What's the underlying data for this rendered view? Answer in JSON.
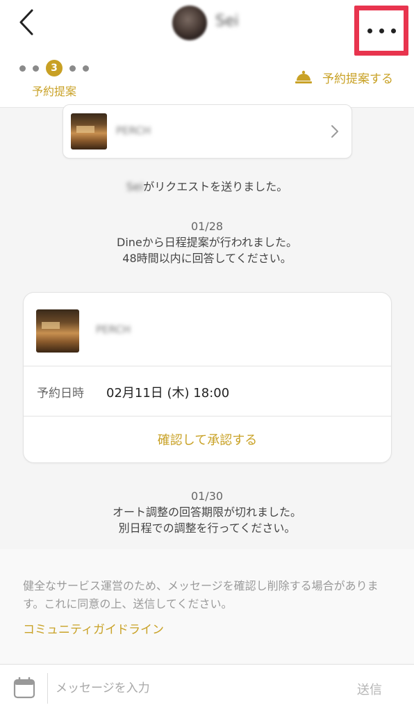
{
  "header": {
    "user_name": "Sei",
    "stepper": {
      "active_step": "3",
      "label": "予約提案"
    },
    "propose_link_label": "予約提案する"
  },
  "shop_card": {
    "name": "PERCH"
  },
  "messages": {
    "request_sent_user": "Sei",
    "request_sent_text": "がリクエストを送りました。",
    "proposal_date": "01/28",
    "proposal_line1": "Dineから日程提案が行われました。",
    "proposal_line2": "48時間以内に回答してください。",
    "expired_date": "01/30",
    "expired_line1": "オート調整の回答期限が切れました。",
    "expired_line2": "別日程での調整を行ってください。"
  },
  "proposal_card": {
    "shop_name": "PERCH",
    "reservation_label": "予約日時",
    "reservation_value": "02月11日 (木) 18:00",
    "confirm_button": "確認して承認する"
  },
  "notice": {
    "text": "健全なサービス運営のため、メッセージを確認し削除する場合があります。これに同意の上、送信してください。",
    "guideline_link": "コミュニティガイドライン"
  },
  "input_bar": {
    "placeholder": "メッセージを入力",
    "send_label": "送信"
  },
  "colors": {
    "accent": "#c9a227",
    "highlight_border": "#e8344e",
    "background": "#f5f5f5"
  },
  "icons": {
    "back": "chevron-left-icon",
    "more": "more-horizontal-icon",
    "bell": "service-bell-icon",
    "chevron": "chevron-right-icon",
    "calendar": "calendar-icon"
  }
}
